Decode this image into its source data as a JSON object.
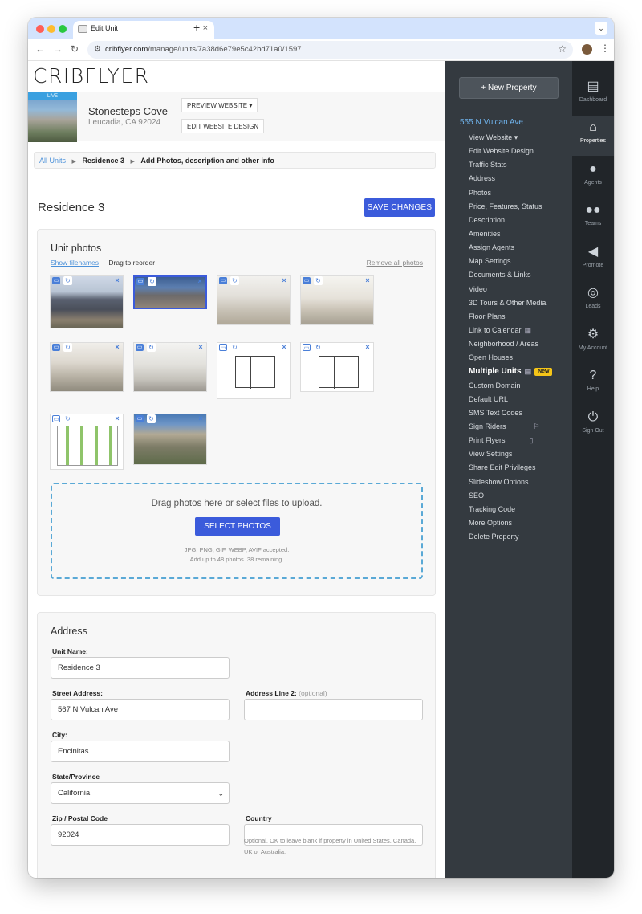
{
  "browser": {
    "tab_title": "Edit Unit",
    "url_domain": "cribflyer.com",
    "url_path": "/manage/units/7a38d6e79e5c42bd71a0/1597"
  },
  "logo": "CRIBFLYER",
  "property": {
    "badge": "LIVE",
    "name": "Stonesteps Cove",
    "location": "Leucadia, CA 92024",
    "preview_label": "PREVIEW WEBSITE",
    "edit_design_label": "EDIT WEBSITE DESIGN"
  },
  "breadcrumb": {
    "link": "All Units",
    "item2": "Residence 3",
    "item3": "Add Photos, description and other info"
  },
  "page": {
    "title": "Residence 3",
    "save_label": "SAVE CHANGES"
  },
  "photos_panel": {
    "title": "Unit photos",
    "show_filenames": "Show filenames",
    "drag_hint": "Drag to reorder",
    "remove_all": "Remove all photos",
    "photos": [
      {
        "subject": "exterior townhomes"
      },
      {
        "subject": "aerial street view"
      },
      {
        "subject": "kitchen"
      },
      {
        "subject": "living dining"
      },
      {
        "subject": "bedroom"
      },
      {
        "subject": "living room tv"
      },
      {
        "subject": "floor plan 1"
      },
      {
        "subject": "floor plan 2"
      },
      {
        "subject": "site plan"
      },
      {
        "subject": "aerial neighborhood"
      }
    ],
    "dropzone_text": "Drag photos here or select files to upload.",
    "select_label": "SELECT PHOTOS",
    "accepted": "JPG, PNG, GIF, WEBP, AVIF accepted.",
    "remaining": "Add up to 48 photos. 38 remaining."
  },
  "address_panel": {
    "title": "Address",
    "unit_name_label": "Unit Name:",
    "unit_name_value": "Residence 3",
    "street_label": "Street Address:",
    "street_value": "567 N Vulcan Ave",
    "line2_label": "Address Line 2:",
    "line2_optional": "(optional)",
    "line2_value": "",
    "city_label": "City:",
    "city_value": "Encinitas",
    "state_label": "State/Province",
    "state_value": "California",
    "zip_label": "Zip / Postal Code",
    "zip_value": "92024",
    "country_label": "Country",
    "country_value": "",
    "country_note": "Optional. OK to leave blank if property in United States, Canada, UK or Australia."
  },
  "sidebar": {
    "new_property": "+ New Property",
    "address": "555 N Vulcan Ave",
    "items": [
      {
        "label": "View Website ▾"
      },
      {
        "label": "Edit Website Design"
      },
      {
        "label": "Traffic Stats"
      },
      {
        "label": "Address"
      },
      {
        "label": "Photos"
      },
      {
        "label": "Price, Features, Status"
      },
      {
        "label": "Description"
      },
      {
        "label": "Amenities"
      },
      {
        "label": "Assign Agents"
      },
      {
        "label": "Map Settings"
      },
      {
        "label": "Documents & Links"
      },
      {
        "label": "Video"
      },
      {
        "label": "3D Tours & Other Media"
      },
      {
        "label": "Floor Plans"
      },
      {
        "label": "Link to Calendar"
      },
      {
        "label": "Neighborhood / Areas"
      },
      {
        "label": "Open Houses"
      },
      {
        "label": "Multiple Units"
      },
      {
        "label": "Custom Domain"
      },
      {
        "label": "Default URL"
      },
      {
        "label": "SMS Text Codes"
      },
      {
        "label": "Sign Riders"
      },
      {
        "label": "Print Flyers"
      },
      {
        "label": "View Settings"
      },
      {
        "label": "Share Edit Privileges"
      },
      {
        "label": "Slideshow Options"
      },
      {
        "label": "SEO"
      },
      {
        "label": "Tracking Code"
      },
      {
        "label": "More Options"
      },
      {
        "label": "Delete Property"
      }
    ],
    "new_badge": "New"
  },
  "rail": [
    {
      "label": "Dashboard",
      "icon": "dashboard-icon"
    },
    {
      "label": "Properties",
      "icon": "properties-icon"
    },
    {
      "label": "Agents",
      "icon": "agent-icon"
    },
    {
      "label": "Teams",
      "icon": "teams-icon"
    },
    {
      "label": "Promote",
      "icon": "megaphone-icon"
    },
    {
      "label": "Leads",
      "icon": "target-icon"
    },
    {
      "label": "My Account",
      "icon": "gear-icon"
    },
    {
      "label": "Help",
      "icon": "help-icon"
    },
    {
      "label": "Sign Out",
      "icon": "power-icon"
    }
  ],
  "colors": {
    "primary_button": "#3b5bdb",
    "link": "#4a90d9",
    "sidebar_bg": "#343a40",
    "rail_bg": "#212529",
    "new_badge": "#f5c518"
  }
}
